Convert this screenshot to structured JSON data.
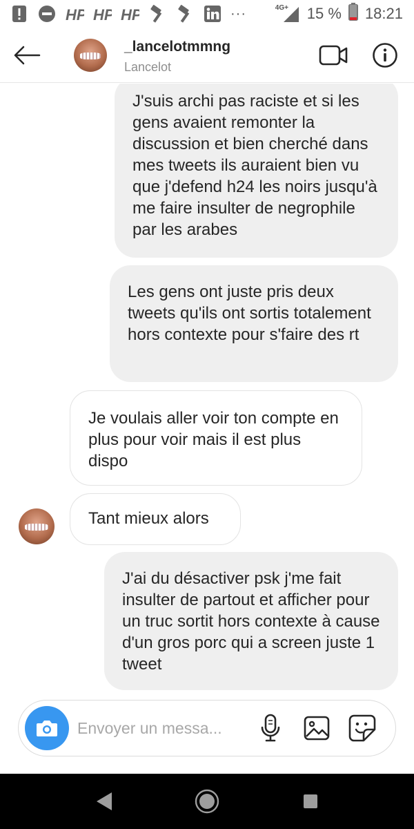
{
  "status_bar": {
    "network": "4G+",
    "battery": "15 %",
    "time": "18:21",
    "overflow": "···"
  },
  "header": {
    "username": "_lancelotmmng",
    "full_name": "Lancelot"
  },
  "messages": [
    {
      "direction": "sent",
      "text": "J'suis archi pas raciste et si les gens avaient remonter la discussion et bien cherché dans mes tweets ils auraient bien vu que j'defend h24 les noirs jusqu'à me faire insulter de negrophile par les arabes"
    },
    {
      "direction": "sent",
      "text": "Les gens ont juste pris deux tweets qu'ils ont sortis totalement hors contexte pour s'faire des rt"
    },
    {
      "direction": "received",
      "text": "Je voulais aller voir ton compte en plus pour voir mais il est plus dispo"
    },
    {
      "direction": "received",
      "text": "Tant mieux alors"
    },
    {
      "direction": "sent",
      "text": "J'ai du désactiver psk j'me fait insulter de partout et afficher pour un truc sortit hors contexte à cause d'un gros porc qui a screen juste 1 tweet"
    }
  ],
  "composer": {
    "placeholder": "Envoyer un messa..."
  },
  "colors": {
    "accent": "#3897f0",
    "sent_bubble": "#efefef",
    "battery_low": "#e0242b"
  }
}
